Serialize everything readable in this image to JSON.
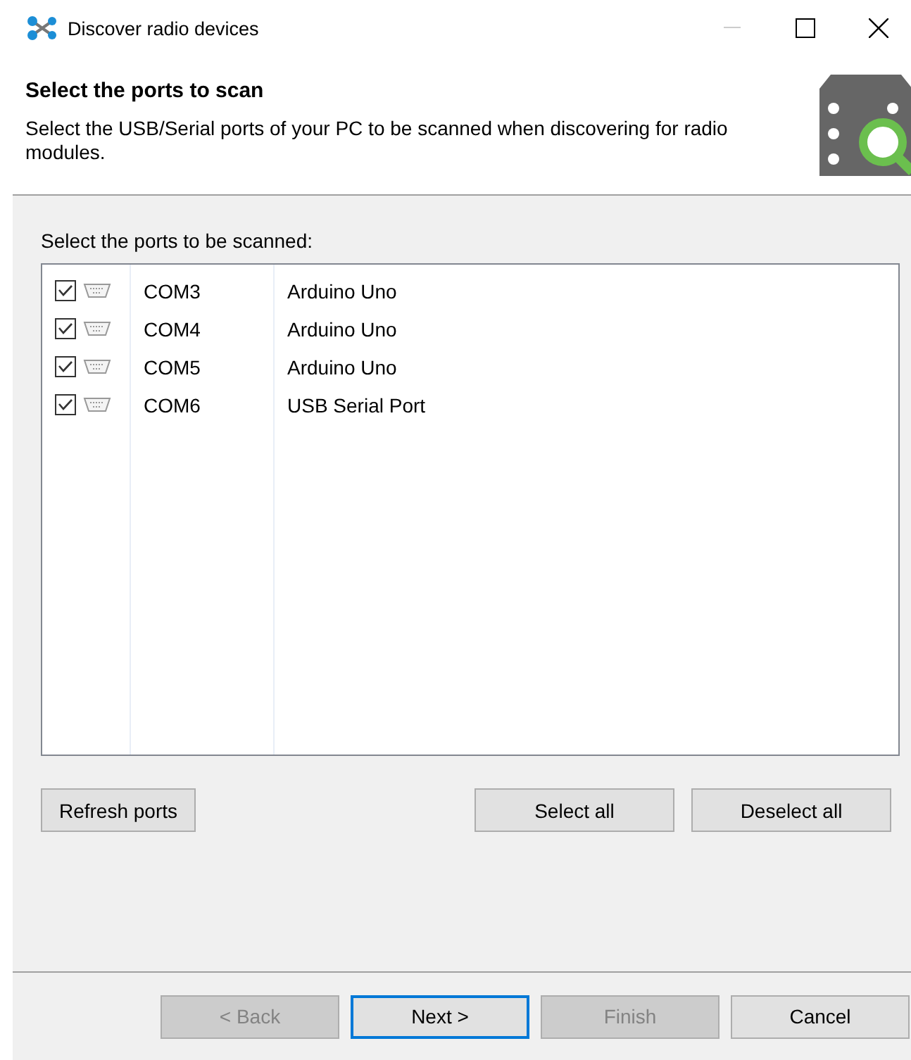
{
  "window": {
    "title": "Discover radio devices"
  },
  "header": {
    "title": "Select the ports to scan",
    "description": "Select the USB/Serial ports of your PC to be scanned when discovering for radio modules."
  },
  "ports_label": "Select the ports to be scanned:",
  "ports": [
    {
      "port": "COM3",
      "description": "Arduino Uno",
      "checked": true
    },
    {
      "port": "COM4",
      "description": "Arduino Uno",
      "checked": true
    },
    {
      "port": "COM5",
      "description": "Arduino Uno",
      "checked": true
    },
    {
      "port": "COM6",
      "description": "USB Serial Port",
      "checked": true
    }
  ],
  "list_buttons": [
    {
      "label": "Refresh ports",
      "kind": "left"
    },
    {
      "label": "Select all",
      "kind": "right"
    },
    {
      "label": "Deselect all",
      "kind": "right"
    }
  ],
  "nav_buttons": [
    {
      "label": "< Back",
      "disabled": true,
      "focused": false
    },
    {
      "label": "Next >",
      "disabled": false,
      "focused": true
    },
    {
      "label": "Finish",
      "disabled": true,
      "focused": false
    },
    {
      "label": "Cancel",
      "disabled": false,
      "focused": false
    }
  ]
}
